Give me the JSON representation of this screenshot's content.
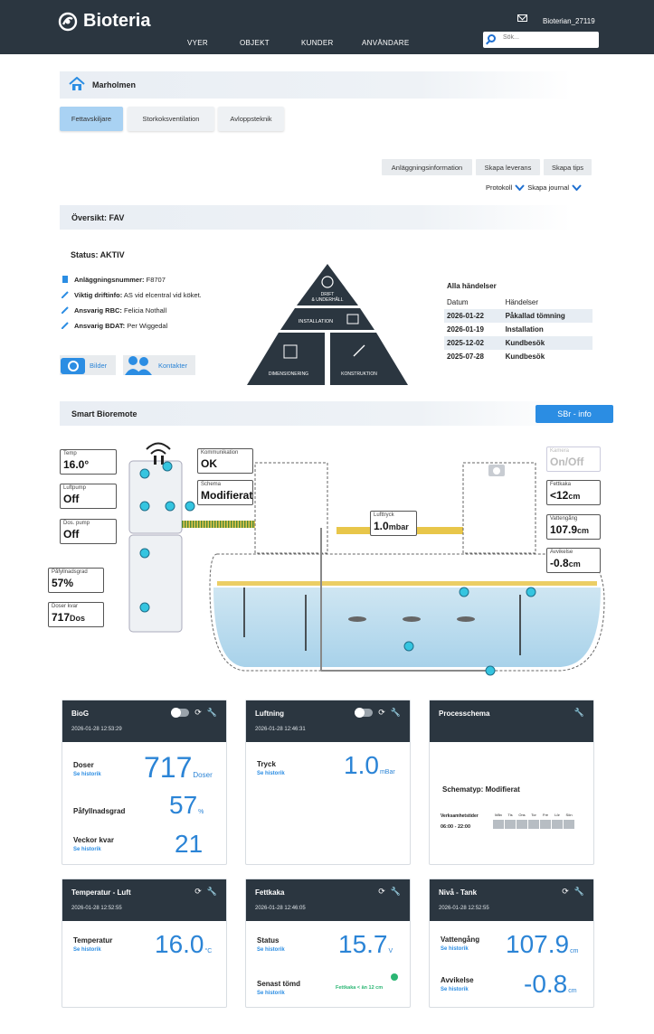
{
  "header": {
    "brand": "Bioteria",
    "nav": [
      "VYER",
      "OBJEKT",
      "KUNDER",
      "ANVÄNDARE"
    ],
    "user": "Bioterian_27119",
    "search_placeholder": "Sök..."
  },
  "site": {
    "name": "Marholmen",
    "tabs": [
      "Fettavskiljare",
      "Storkoksventilation",
      "Avloppsteknik"
    ],
    "active_tab": "Fettavskiljare",
    "actions": [
      "Anläggningsinformation",
      "Skapa leverans",
      "Skapa tips"
    ],
    "links": [
      "Protokoll",
      "Skapa journal"
    ]
  },
  "overview": {
    "title": "Översikt: FAV",
    "status": "Status: AKTIV",
    "info": [
      {
        "label": "Anläggningsnummer:",
        "value": "F8707"
      },
      {
        "label": "Viktig driftinfo:",
        "value": "AS vid elcentral vid köket."
      },
      {
        "label": "Ansvarig RBC:",
        "value": "Felicia Nothall"
      },
      {
        "label": "Ansvarig BDAT:",
        "value": "Per Wiggedal"
      }
    ],
    "buttons": [
      "Bilder",
      "Kontakter"
    ],
    "pyramid": {
      "top": "DRIFT\n& UNDERHÅLL",
      "middle": "INSTALLATION",
      "left": "DIMENSIONERING",
      "right": "KONSTRUKTION"
    },
    "events_title": "Alla händelser",
    "events_headers": [
      "Datum",
      "Händelser"
    ],
    "events": [
      [
        "2026-01-22",
        "Påkallad tömning"
      ],
      [
        "2026-01-19",
        "Installation"
      ],
      [
        "2025-12-02",
        "Kundbesök"
      ],
      [
        "2025-07-28",
        "Kundbesök"
      ]
    ]
  },
  "smart": {
    "title": "Smart Bioremote",
    "info_button": "SBr - info",
    "labels": {
      "temp": {
        "t": "Temp",
        "v": "16.0°"
      },
      "luftpump": {
        "t": "Luftpump",
        "v": "Off"
      },
      "dospump": {
        "t": "Dos. pump",
        "v": "Off"
      },
      "kommunikation": {
        "t": "Kommunikation",
        "v": "OK"
      },
      "schema": {
        "t": "Schema",
        "v": "Modifierat"
      },
      "pafyll": {
        "t": "Påfyllnadsgrad",
        "v": "57%"
      },
      "doser": {
        "t": "Doser kvar",
        "v": "717",
        "u": "Dos"
      },
      "lufttryck": {
        "t": "Lufttryck",
        "v": "1.0",
        "u": "mbar"
      },
      "kamera": {
        "t": "Kamera",
        "v": "On/Off"
      },
      "fettkaka": {
        "t": "Fettkaka",
        "v": "<12",
        "u": "cm"
      },
      "vattengang": {
        "t": "Vattengång",
        "v": "107.9",
        "u": "cm"
      },
      "avvikelse": {
        "t": "Avvikelse",
        "v": "-0.8",
        "u": "cm"
      }
    }
  },
  "cards": [
    {
      "title": "BioG",
      "ts": "2026-01-28 12:53:29"
    },
    {
      "title": "Luftning",
      "ts": "2026-01-28 12:46:31"
    },
    {
      "title": "Processchema",
      "ts": ""
    },
    {
      "title": "Temperatur - Luft",
      "ts": "2026-01-28 12:52:55"
    },
    {
      "title": "Fettkaka",
      "ts": "2026-01-28 12:46:05"
    },
    {
      "title": "Nivå - Tank",
      "ts": "2026-01-28 12:52:55"
    }
  ],
  "metrics": {
    "hist": "Se historik",
    "doser": {
      "label": "Doser",
      "value": "717",
      "unit": "Doser"
    },
    "pafyll": {
      "label": "Påfyllnadsgrad",
      "value": "57",
      "unit": "%"
    },
    "veckor": {
      "label": "Veckor kvar",
      "value": "21"
    },
    "tryck": {
      "label": "Tryck",
      "value": "1.0",
      "unit": "mBar"
    },
    "schematyp": "Schematyp: Modifierat",
    "verksamhet": "Verksamhetstider",
    "tider": "06:00 - 22:00",
    "days": [
      "Mån",
      "Tis",
      "Ons",
      "Tor",
      "Fre",
      "Lör",
      "Sön"
    ],
    "temperatur": {
      "label": "Temperatur",
      "value": "16.0",
      "unit": "°C"
    },
    "status": {
      "label": "Status",
      "value": "15.7",
      "unit": "V"
    },
    "senast": {
      "label": "Senast tömd",
      "note": "Fettkaka < än 12 cm"
    },
    "vattengang": {
      "label": "Vattengång",
      "value": "107.9",
      "unit": "cm"
    },
    "avvikelse": {
      "label": "Avvikelse",
      "value": "-0.8",
      "unit": "cm"
    }
  }
}
